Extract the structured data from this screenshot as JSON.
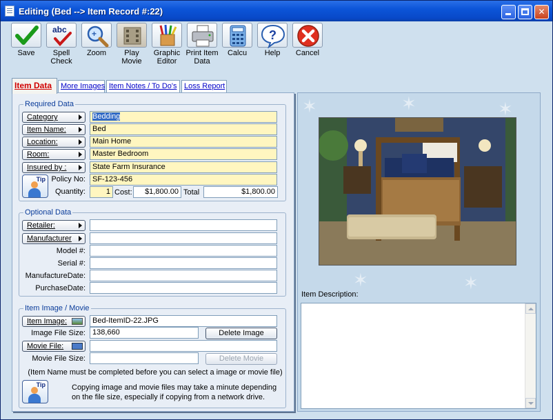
{
  "window": {
    "title": "Editing  (Bed --> Item Record #:22)",
    "minimize_label": "",
    "maximize_label": "",
    "close_label": "✕"
  },
  "toolbar": {
    "save": "Save",
    "spell_check_1": "Spell",
    "spell_check_2": "Check",
    "spell_abc": "abc",
    "zoom": "Zoom",
    "play_movie_1": "Play",
    "play_movie_2": "Movie",
    "graphic_editor_1": "Graphic",
    "graphic_editor_2": "Editor",
    "print_item_data_1": "Print Item",
    "print_item_data_2": "Data",
    "calcu": "Calcu",
    "help": "Help",
    "cancel": "Cancel"
  },
  "tabs": [
    {
      "label": "Item Data"
    },
    {
      "label": "More Images"
    },
    {
      "label": "Item Notes / To Do's"
    },
    {
      "label": "Loss Report"
    }
  ],
  "required": {
    "legend": "Required Data",
    "category_label": "Category",
    "category_value": "Bedding",
    "item_name_label": "Item Name:",
    "item_name_value": "Bed",
    "location_label": "Location:",
    "location_value": "Main Home",
    "room_label": "Room:",
    "room_value": "Master Bedroom",
    "insured_by_label": "Insured by :",
    "insured_by_value": "State Farm Insurance",
    "policy_no_label": "Policy No:",
    "policy_no_value": "SF-123-456",
    "quantity_label": "Quantity:",
    "quantity_value": "1",
    "cost_label": "Cost:",
    "cost_value": "$1,800.00",
    "total_label": "Total",
    "total_value": "$1,800.00",
    "tip_label": "Tip"
  },
  "optional": {
    "legend": "Optional Data",
    "retailer_label": "Retailer:",
    "retailer_value": "",
    "manufacturer_label": "Manufacturer",
    "manufacturer_value": "",
    "model_label": "Model #:",
    "model_value": "",
    "serial_label": "Serial #:",
    "serial_value": "",
    "manufacture_date_label": "ManufactureDate:",
    "manufacture_date_value": "",
    "purchase_date_label": "PurchaseDate:",
    "purchase_date_value": ""
  },
  "media": {
    "legend": "Item Image / Movie",
    "item_image_label": "Item Image:",
    "item_image_value": "Bed-ItemID-22.JPG",
    "image_size_label": "Image File Size:",
    "image_size_value": "138,660",
    "delete_image": "Delete Image",
    "movie_file_label": "Movie File:",
    "movie_file_value": "",
    "movie_size_label": "Movie File Size:",
    "movie_size_value": "",
    "delete_movie": "Delete Movie",
    "note_required": "(Item Name must be completed before you can select a image or movie file)",
    "note_copy_1": "Copying image and movie files may take a minute depending",
    "note_copy_2": "on the file size, especially if copying from a network drive.",
    "tip_label": "Tip"
  },
  "right": {
    "item_description_label": "Item Description:",
    "item_description_value": ""
  },
  "colors": {
    "titlebar": "#0c55d8",
    "required_field_bg": "#fff6c0",
    "active_tab_text": "#d00000",
    "link_tab_text": "#0000c8",
    "panel_bg": "#c5d9ea"
  }
}
